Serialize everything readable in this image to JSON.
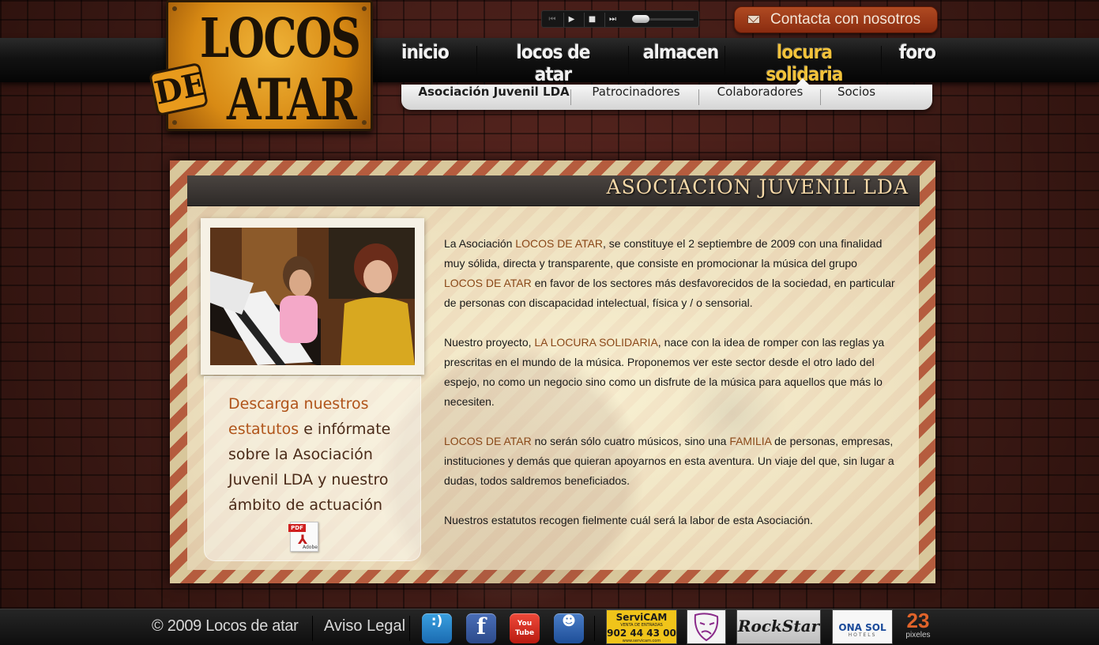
{
  "site": {
    "logo_top": "LOCOS",
    "logo_de": "DE",
    "logo_bottom": "ATAR"
  },
  "player": {
    "prev_icon": "⏮",
    "play_icon": "▶",
    "stop_icon": "■",
    "next_icon": "⏭",
    "volume_level": 0.25
  },
  "contact": {
    "label": "Contacta con nosotros"
  },
  "nav": {
    "items": [
      {
        "label": "inicio"
      },
      {
        "label": "locos de atar"
      },
      {
        "label": "almacen"
      },
      {
        "label": "locura solidaria"
      },
      {
        "label": "foro"
      }
    ]
  },
  "subnav": {
    "items": [
      {
        "label": "Asociación Juvenil LDA"
      },
      {
        "label": "Patrocinadores"
      },
      {
        "label": "Colaboradores"
      },
      {
        "label": "Socios"
      }
    ]
  },
  "content": {
    "title": "ASOCIACION JUVENIL LDA",
    "side_link": "Descarga nuestros estatutos",
    "side_text": " e infórmate sobre la Asociación Juvenil LDA y nuestro ámbito de actuación",
    "pdf_tag": "PDF",
    "pdf_brand": "Adobe",
    "p1_a": "La Asociación ",
    "p1_b": "LOCOS DE ATAR",
    "p1_c": ", se constituye el 2 septiembre de 2009 con una finalidad muy sólida, directa y transparente, que consiste en promocionar la música del grupo ",
    "p1_d": "LOCOS DE ATAR",
    "p1_e": " en favor de los sectores más desfavorecidos de la sociedad, en particular de personas con discapacidad intelectual, física y / o sensorial.",
    "p2_a": "Nuestro proyecto, ",
    "p2_b": "LA LOCURA SOLIDARIA",
    "p2_c": ", nace con la idea de romper con las reglas ya prescritas en el mundo de la música. Proponemos ver este sector desde el otro lado del espejo, no como un negocio sino como un disfrute de la música para aquellos que más lo necesiten.",
    "p3_a": "LOCOS DE ATAR",
    "p3_b": " no serán sólo cuatro músicos, sino una ",
    "p3_c": "FAMILIA",
    "p3_d": " de personas, empresas, instituciones y demás que quieran apoyarnos en esta aventura. Un viaje del que, sin lugar a dudas, todos saldremos beneficiados.",
    "p4": "Nuestros estatutos recogen fielmente cuál será la labor de esta Asociación."
  },
  "footer": {
    "copyright": "© 2009  Locos de atar",
    "legal": "Aviso Legal",
    "social": [
      {
        "glyph": ":)"
      },
      {
        "glyph": "f"
      },
      {
        "glyph": "You Tube"
      },
      {
        "glyph": "☻"
      }
    ],
    "sponsors": [
      {
        "title": "ServiCAM",
        "sub": "VENTA DE ENTRADAS",
        "phone": "902 44 43 00",
        "web": "www.servicam.com"
      },
      {
        "name": ""
      },
      {
        "name": "RockStar"
      },
      {
        "name": "ONA SOL",
        "sub": "HOTELS"
      },
      {
        "num": "23",
        "sub": "pixeles"
      }
    ]
  }
}
